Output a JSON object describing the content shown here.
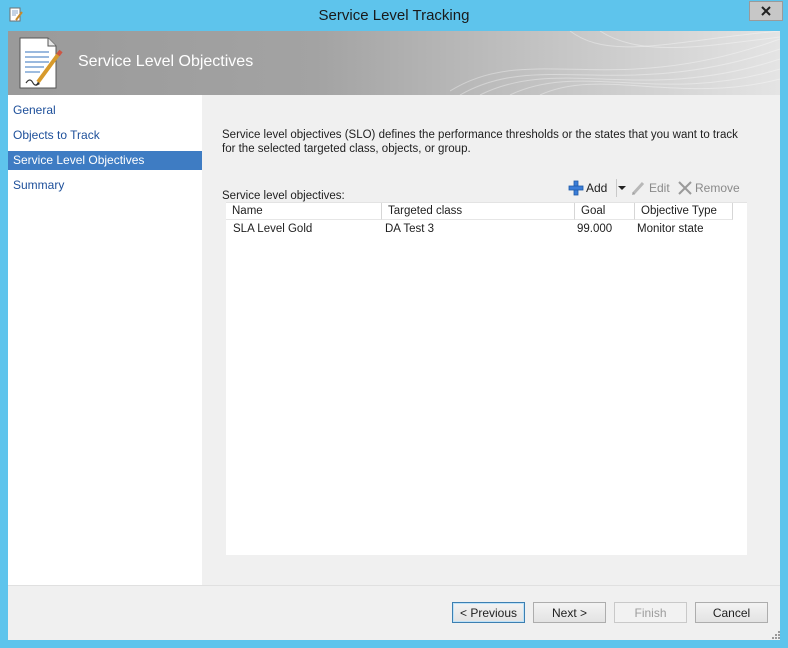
{
  "window": {
    "title": "Service Level Tracking"
  },
  "banner": {
    "title": "Service Level Objectives"
  },
  "nav": {
    "items": [
      {
        "label": "General"
      },
      {
        "label": "Objects to Track"
      },
      {
        "label": "Service Level Objectives"
      },
      {
        "label": "Summary"
      }
    ],
    "selected": "Service Level Objectives"
  },
  "content": {
    "description": "Service level objectives (SLO) defines the performance thresholds or the states that you want to track for the selected targeted class, objects, or group.",
    "list_label": "Service level objectives:",
    "toolbar": {
      "add": "Add",
      "edit": "Edit",
      "remove": "Remove"
    },
    "grid": {
      "columns": [
        "Name",
        "Targeted class",
        "Goal",
        "Objective Type"
      ],
      "rows": [
        [
          "SLA Level Gold",
          "DA Test 3",
          "99.000",
          "Monitor state"
        ]
      ]
    }
  },
  "footer": {
    "previous": "< Previous",
    "next": "Next >",
    "finish": "Finish",
    "cancel": "Cancel"
  },
  "icons": {
    "title": "document-pencil-icon",
    "banner": "document-signature-icon",
    "close": "close-icon",
    "add": "plus-icon",
    "dropdown": "chevron-down-icon",
    "edit": "pencil-icon",
    "remove": "x-icon",
    "grip": "resize-grip-icon"
  },
  "colors": {
    "title_bar": "#5ec4ec",
    "selected_nav": "#3e7cc3",
    "nav_link": "#1d4f9a"
  }
}
